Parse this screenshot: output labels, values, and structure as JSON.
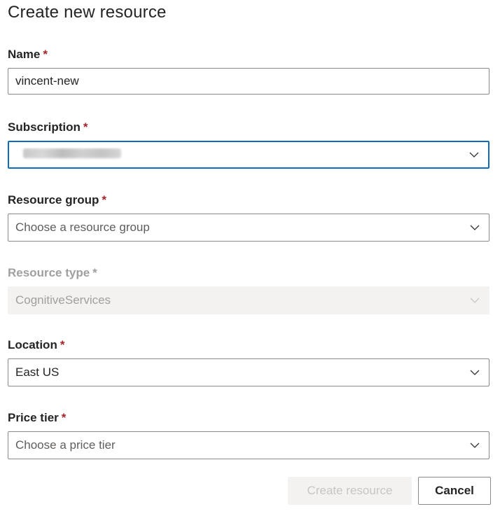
{
  "dialog": {
    "title": "Create new resource"
  },
  "required_marker": "*",
  "fields": {
    "name": {
      "label": "Name",
      "value": "vincent-new"
    },
    "subscription": {
      "label": "Subscription",
      "value": "Contoso Subscription"
    },
    "resource_group": {
      "label": "Resource group",
      "placeholder": "Choose a resource group"
    },
    "resource_type": {
      "label": "Resource type",
      "value": "CognitiveServices"
    },
    "location": {
      "label": "Location",
      "value": "East US"
    },
    "price_tier": {
      "label": "Price tier",
      "placeholder": "Choose a price tier"
    }
  },
  "buttons": {
    "create": "Create resource",
    "cancel": "Cancel"
  },
  "icons": {
    "dropdown": "chevron-down-icon"
  },
  "colors": {
    "accent": "#0f6cbd",
    "required": "#a4262c",
    "disabled_bg": "#f3f2f1"
  }
}
